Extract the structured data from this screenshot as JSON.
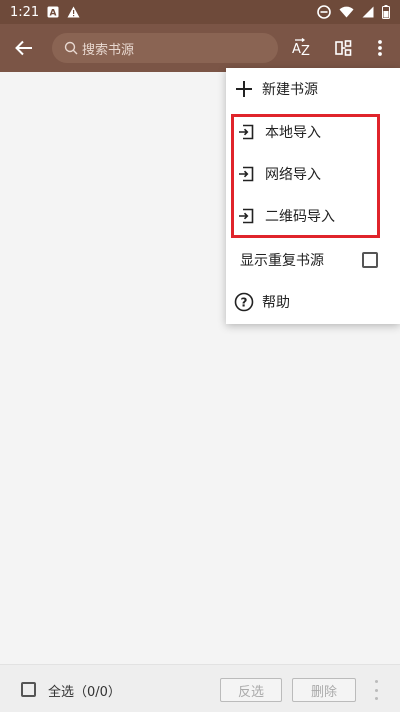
{
  "status_bar": {
    "time": "1:21",
    "left_icons": [
      "app-a-icon",
      "warning-icon"
    ],
    "right_icons": [
      "do-not-disturb-icon",
      "wifi-icon",
      "cellular-icon",
      "battery-icon"
    ]
  },
  "toolbar": {
    "back_icon": "arrow-left-icon",
    "search_placeholder": "搜索书源",
    "sort_icon": "az-sort-icon",
    "group_icon": "group-icon",
    "more_icon": "more-vert-icon"
  },
  "menu": {
    "new_source": "新建书源",
    "local_import": "本地导入",
    "network_import": "网络导入",
    "qr_import": "二维码导入",
    "show_duplicates": "显示重复书源",
    "show_duplicates_checked": false,
    "help": "帮助"
  },
  "bottom_bar": {
    "select_all_label": "全选（0/0）",
    "invert_label": "反选",
    "delete_label": "删除"
  },
  "colors": {
    "toolbar": "#7b5546",
    "status_bar": "#6e4a3a",
    "highlight": "#e0242b"
  }
}
